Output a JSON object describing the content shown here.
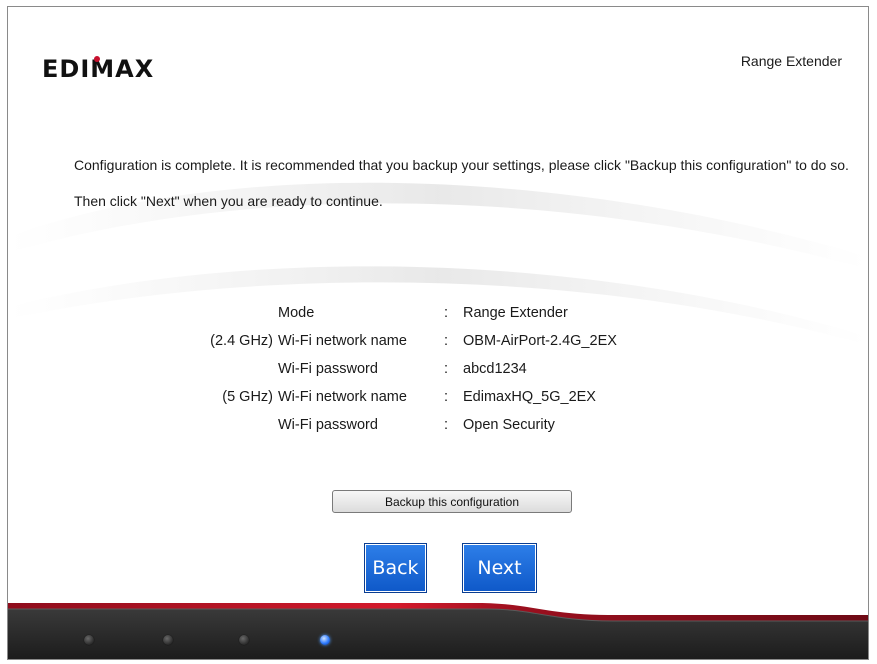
{
  "header": {
    "logo_text": "EDIMAX",
    "product_name": "Range Extender"
  },
  "message": "Configuration is complete. It is recommended that you backup your settings, please click \"Backup this configuration\" to do so. Then click \"Next\" when you are ready to continue.",
  "summary": [
    {
      "band": "",
      "label": "Mode",
      "value": "Range Extender"
    },
    {
      "band": "(2.4 GHz)",
      "label": "Wi-Fi network name",
      "value": "OBM-AirPort-2.4G_2EX"
    },
    {
      "band": "",
      "label": "Wi-Fi password",
      "value": "abcd1234"
    },
    {
      "band": "(5 GHz)",
      "label": "Wi-Fi network name",
      "value": "EdimaxHQ_5G_2EX"
    },
    {
      "band": "",
      "label": "Wi-Fi password",
      "value": "Open Security"
    }
  ],
  "separator": ":",
  "buttons": {
    "backup_label": "Backup this configuration",
    "back_label": "Back",
    "next_label": "Next"
  },
  "progress": {
    "total_steps": 4,
    "current_step": 4
  },
  "colors": {
    "accent_blue": "#1565d8",
    "footer_red": "#c8102e",
    "footer_dark": "#2b2b2b"
  }
}
